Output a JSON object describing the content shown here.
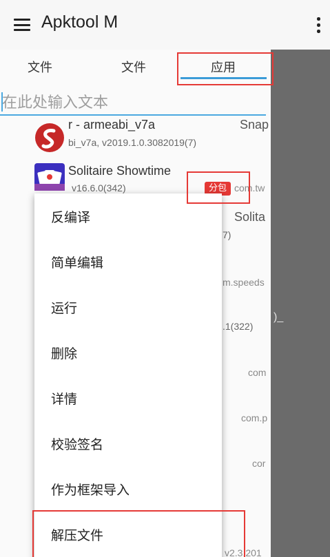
{
  "toolbar": {
    "title": "Apktool M",
    "menu_icon": "hamburger-menu-icon",
    "overflow_icon": "more-vert-icon"
  },
  "tabs": [
    {
      "label": "文件"
    },
    {
      "label": "文件"
    },
    {
      "label": "应用"
    }
  ],
  "search": {
    "placeholder": "在此处输入文本"
  },
  "list": {
    "item1": {
      "title": "r - armeabi_v7a",
      "subtitle": "bi_v7a, v2019.1.0.3082019(7)",
      "pkg": "Snap"
    },
    "item2": {
      "title": "Solitaire Showtime",
      "subtitle": "v16.6.0(342)",
      "badge": "分包",
      "pkg": "com.tw"
    }
  },
  "behind": {
    "t1": "Solita",
    "t2": "7)",
    "t3": "m.speeds",
    "t4": ")_",
    "t5": ".1(322)",
    "t6": "com",
    "t7": "com.p",
    "t8": "cor",
    "t9": "v2.3.201"
  },
  "context_menu": [
    {
      "label": "反编译"
    },
    {
      "label": "简单编辑"
    },
    {
      "label": "运行"
    },
    {
      "label": "删除"
    },
    {
      "label": "详情"
    },
    {
      "label": "校验签名"
    },
    {
      "label": "作为框架导入"
    },
    {
      "label": "解压文件"
    }
  ],
  "colors": {
    "accent": "#3b9bd8",
    "highlight": "#e53935",
    "scrim": "#6b6b6b"
  }
}
